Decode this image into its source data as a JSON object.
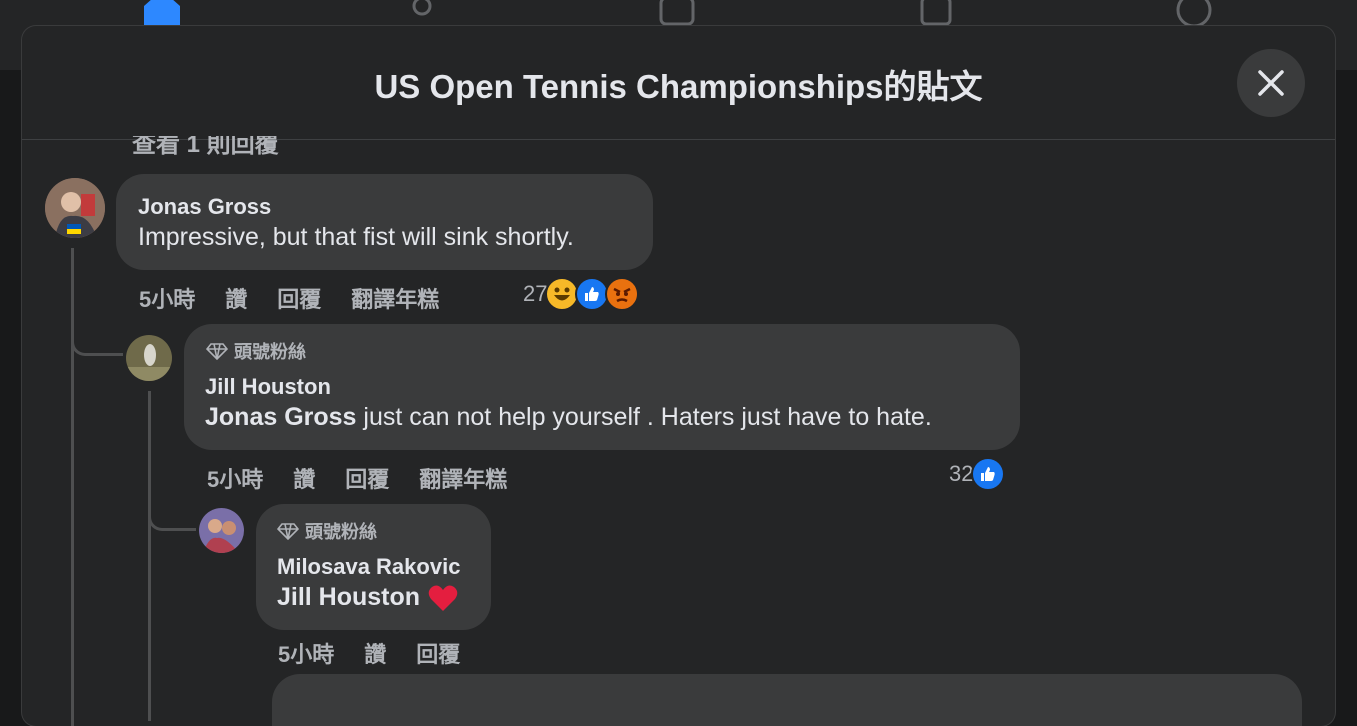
{
  "modal": {
    "title": "US Open Tennis Championships的貼文",
    "cut_text": "查看 1 則回覆"
  },
  "comments": [
    {
      "author": "Jonas Gross",
      "text": "Impressive, but that fist will sink shortly.",
      "time": "5小時",
      "like": "讚",
      "reply": "回覆",
      "translate": "翻譯年糕",
      "reaction_count": "27",
      "reactions": [
        "haha-icon",
        "like-icon",
        "angry-icon"
      ]
    },
    {
      "badge": "頭號粉絲",
      "author": "Jill Houston",
      "mention": "Jonas Gross",
      "text": " just can not help yourself . Haters just have to hate.",
      "time": "5小時",
      "like": "讚",
      "reply": "回覆",
      "translate": "翻譯年糕",
      "reaction_count": "32",
      "reactions": [
        "like-icon"
      ]
    },
    {
      "badge": "頭號粉絲",
      "author": "Milosava Rakovic",
      "mention": "Jill Houston",
      "text": "❤️",
      "time": "5小時",
      "like": "讚",
      "reply": "回覆"
    }
  ],
  "colors": {
    "background": "#18191a",
    "modal": "#242526",
    "bubble": "#3a3b3c",
    "text": "#e4e6eb",
    "secondary": "#b0b3b8",
    "like_blue": "#1877f2",
    "angry": "#e9710f"
  }
}
